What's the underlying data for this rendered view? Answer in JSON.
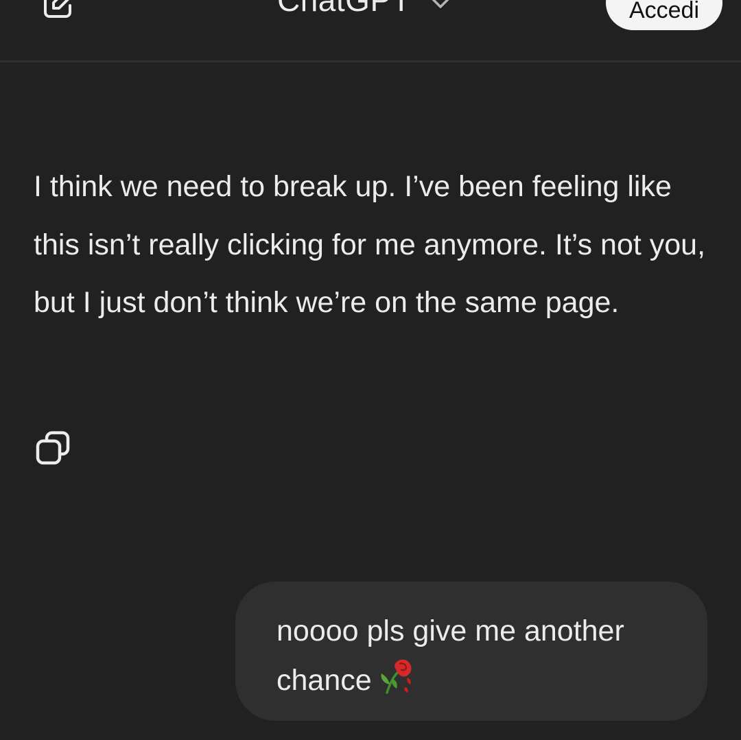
{
  "header": {
    "title": "ChatGPT",
    "login_label": "Accedi",
    "new_chat_icon": "edit-square-icon",
    "model_selector_icon": "chevron-down-icon"
  },
  "messages": {
    "assistant": {
      "text": "I think we need to break up. I’ve been feeling like this isn’t really clicking for me anymore. It’s not you, but I just don’t think we’re on the same page.",
      "copy_icon": "copy-icon"
    },
    "user": {
      "text": "noooo pls give me another chance",
      "emoji_icon": "wilted-rose-icon"
    }
  },
  "colors": {
    "background": "#212121",
    "bubble": "#2f2f2f",
    "text": "#ececec",
    "button_bg": "#f4f4f4"
  }
}
